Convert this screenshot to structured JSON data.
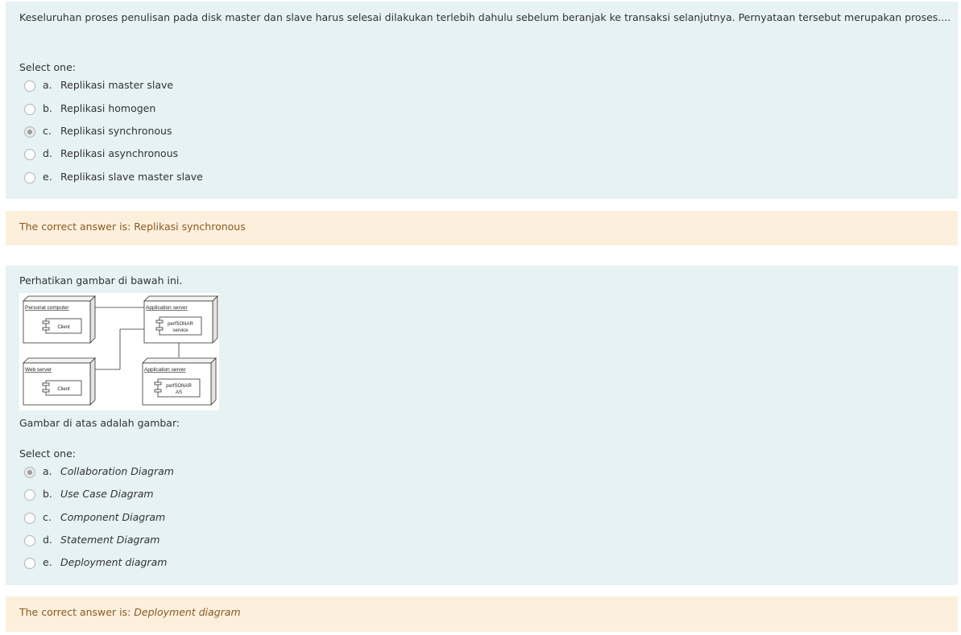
{
  "q1": {
    "text": "Keseluruhan proses penulisan pada disk master dan slave harus selesai dilakukan terlebih dahulu sebelum beranjak ke transaksi selanjutnya. Pernyataan tersebut merupakan proses....",
    "select_label": "Select one:",
    "options": [
      {
        "letter": "a.",
        "text": "Replikasi master slave"
      },
      {
        "letter": "b.",
        "text": "Replikasi homogen"
      },
      {
        "letter": "c.",
        "text": "Replikasi synchronous"
      },
      {
        "letter": "d.",
        "text": "Replikasi asynchronous"
      },
      {
        "letter": "e.",
        "text": "Replikasi slave master slave"
      }
    ],
    "selected_letter": "c.",
    "feedback_prefix": "The correct answer is:",
    "feedback_answer": "Replikasi synchronous"
  },
  "q2": {
    "text": "Perhatikan gambar di bawah ini.",
    "question": "Gambar di atas adalah gambar:",
    "select_label": "Select one:",
    "diagram": {
      "nodes": [
        {
          "title": "Personal computer",
          "component": "Client"
        },
        {
          "title": "Application server",
          "component_line1": "perfSONAR",
          "component_line2": "service"
        },
        {
          "title": "Web server",
          "component": "Client"
        },
        {
          "title": "Application server",
          "component_line1": "perfSONAR",
          "component_line2": "AS"
        }
      ]
    },
    "options": [
      {
        "letter": "a.",
        "text": "Collaboration Diagram"
      },
      {
        "letter": "b.",
        "text": "Use Case Diagram"
      },
      {
        "letter": "c.",
        "text": "Component Diagram"
      },
      {
        "letter": "d.",
        "text": "Statement Diagram"
      },
      {
        "letter": "e.",
        "text": "Deployment diagram"
      }
    ],
    "selected_letter": "a.",
    "feedback_prefix": "The correct answer is:",
    "feedback_answer": "Deployment diagram"
  }
}
